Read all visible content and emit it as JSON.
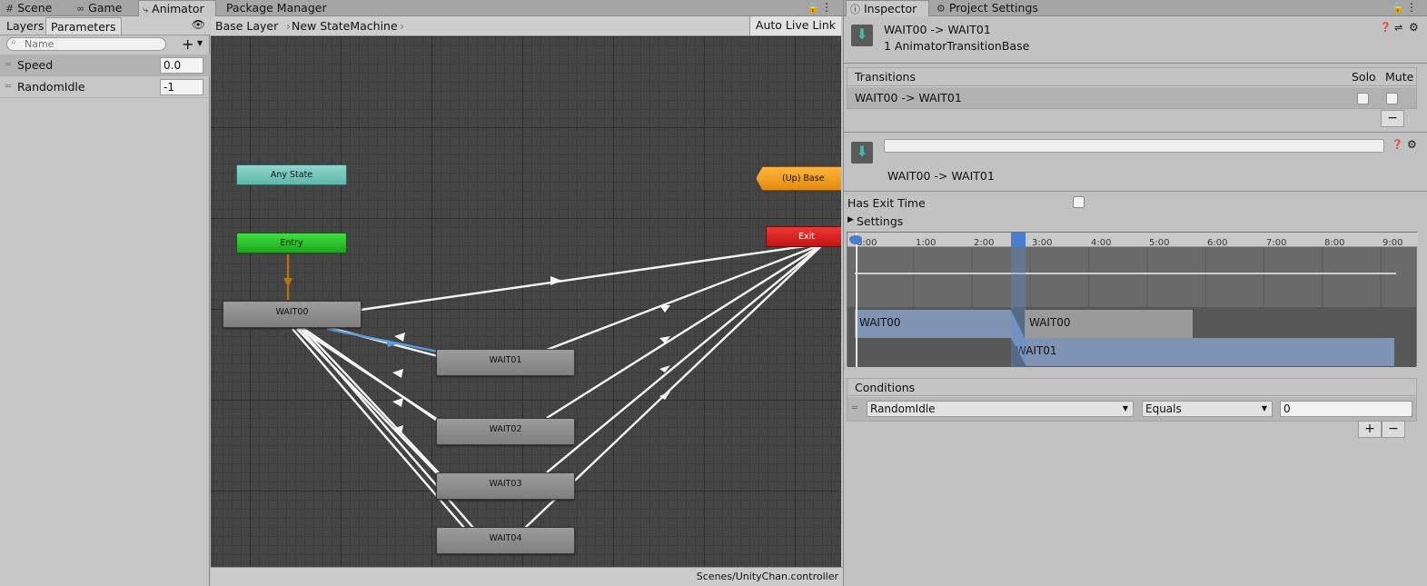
{
  "tabs": [
    {
      "label": "Scene",
      "icon": "grid-icon"
    },
    {
      "label": "Game",
      "icon": "gamepad-icon"
    },
    {
      "label": "Animator",
      "icon": "animator-icon"
    },
    {
      "label": "Package Manager",
      "icon": ""
    }
  ],
  "left": {
    "tabs": [
      "Layers",
      "Parameters"
    ],
    "search_placeholder": "Name",
    "params": [
      {
        "name": "Speed",
        "value": "0.0"
      },
      {
        "name": "RandomIdle",
        "value": "-1"
      }
    ]
  },
  "breadcrumb": [
    "Base Layer",
    "New StateMachine"
  ],
  "auto_live_link": "Auto Live Link",
  "nodes": {
    "any": "Any State",
    "entry": "Entry",
    "exit": "Exit",
    "up": "(Up) Base Layer",
    "wait00": "WAIT00",
    "wait01": "WAIT01",
    "wait02": "WAIT02",
    "wait03": "WAIT03",
    "wait04": "WAIT04"
  },
  "status_path": "Scenes/UnityChan.controller",
  "inspector": {
    "tabs": [
      "Inspector",
      "Project Settings"
    ],
    "title": "WAIT00 -> WAIT01",
    "subtitle": "1 AnimatorTransitionBase",
    "transitions_header": "Transitions",
    "solo": "Solo",
    "mute": "Mute",
    "transition_row": "WAIT00 -> WAIT01",
    "name_field": "",
    "transition_label": "WAIT00 -> WAIT01",
    "has_exit_time": "Has Exit Time",
    "settings": "Settings",
    "ruler": [
      "0:00",
      "1:00",
      "2:00",
      "3:00",
      "4:00",
      "5:00",
      "6:00",
      "7:00",
      "8:00",
      "9:00"
    ],
    "clip_a": "WAIT00",
    "clip_a2": "WAIT00",
    "clip_b": "WAIT01",
    "conditions_header": "Conditions",
    "condition": {
      "param": "RandomIdle",
      "mode": "Equals",
      "value": "0"
    },
    "plus": "+",
    "minus": "−"
  },
  "colors": {
    "any": "#6fc3b7",
    "entry": "#26bd2a",
    "exit": "#d82020",
    "up": "#ee9a1c",
    "selected_transition": "#5b9bdc"
  }
}
